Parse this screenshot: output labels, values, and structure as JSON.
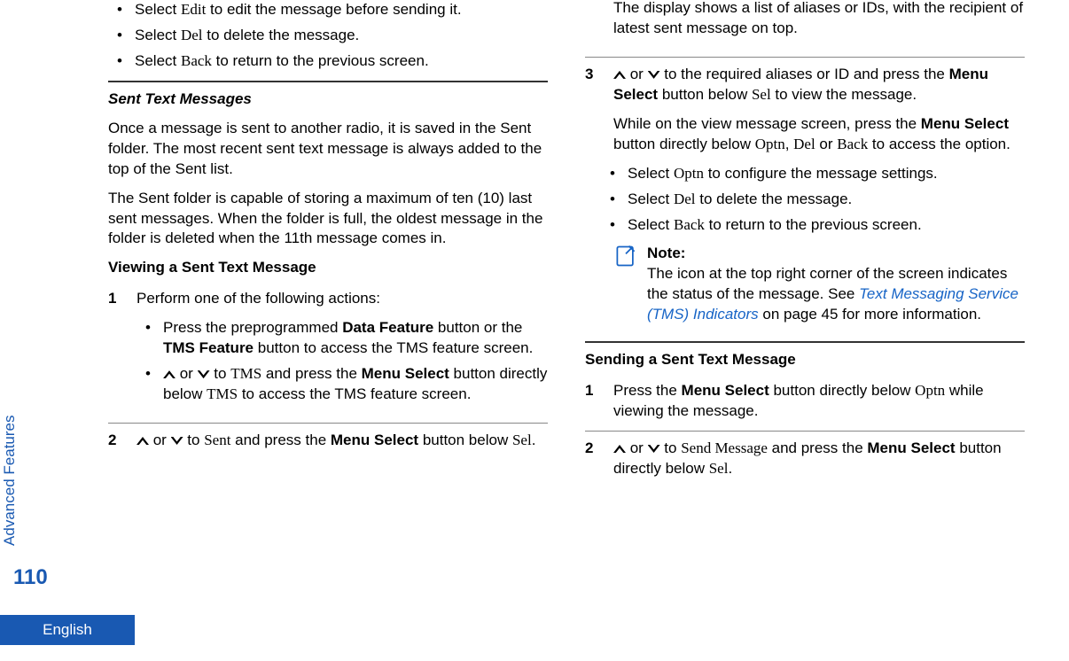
{
  "sidebar": {
    "label": "Advanced Features"
  },
  "pageNumber": "110",
  "language": "English",
  "left": {
    "topBullets": [
      {
        "pre": "Select ",
        "key": "Edit",
        "post": " to edit the message before sending it."
      },
      {
        "pre": "Select ",
        "key": "Del",
        "post": " to delete the message."
      },
      {
        "pre": "Select ",
        "key": "Back",
        "post": " to return to the previous screen."
      }
    ],
    "sentHeading": "Sent Text Messages",
    "sentPara1": "Once a message is sent to another radio, it is saved in the Sent folder. The most recent sent text message is always added to the top of the Sent list.",
    "sentPara2": "The Sent folder is capable of storing a maximum of ten (10) last sent messages. When the folder is full, the oldest message in the folder is deleted when the 11th message comes in.",
    "viewHeading": "Viewing a Sent Text Message",
    "step1Intro": "Perform one of the following actions:",
    "step1Bullet1": {
      "pre": "Press the preprogrammed ",
      "b1": "Data Feature",
      "mid1": " button or the ",
      "b2": "TMS Feature",
      "post": " button to access the TMS feature screen."
    },
    "step1Bullet2": {
      "mid1": " or ",
      "mid2": " to ",
      "key1": "TMS",
      "mid3": " and press the ",
      "b1": "Menu Select",
      "mid4": " button directly below ",
      "key2": "TMS",
      "post": " to access the TMS feature screen."
    },
    "step2": {
      "mid1": " or ",
      "mid2": " to ",
      "key1": "Sent",
      "mid3": " and press the ",
      "b1": "Menu Select",
      "mid4": " button below ",
      "key2": "Sel",
      "post": "."
    }
  },
  "right": {
    "topPara": "The display shows a list of aliases or IDs, with the recipient of latest sent message on top.",
    "step3a": {
      "mid1": " or ",
      "mid2": " to the required aliases or ID and press the ",
      "b1": "Menu Select",
      "mid3": " button below ",
      "key1": "Sel",
      "post": " to view the message."
    },
    "step3b": {
      "pre": "While on the view message screen, press the ",
      "b1": "Menu Select",
      "mid1": " button directly below ",
      "key1": "Optn",
      "sep1": ", ",
      "key2": "Del",
      "mid2": " or ",
      "key3": "Back",
      "post": " to access the option."
    },
    "bullets": [
      {
        "pre": "Select ",
        "key": "Optn",
        "post": " to configure the message settings."
      },
      {
        "pre": "Select ",
        "key": "Del",
        "post": " to delete the message."
      },
      {
        "pre": "Select ",
        "key": "Back",
        "post": " to return to the previous screen."
      }
    ],
    "noteTitle": "Note:",
    "noteBodyPre": "The icon at the top right corner of the screen indicates the status of the message. See ",
    "noteLink": "Text Messaging Service (TMS) Indicators",
    "noteBodyPost": " on page 45 for more information.",
    "sendHeading": "Sending a Sent Text Message",
    "step1": {
      "pre": "Press the ",
      "b1": "Menu Select",
      "mid1": " button directly below ",
      "key1": "Optn",
      "post": " while viewing the message."
    },
    "step2": {
      "mid1": " or ",
      "mid2": " to ",
      "key1": "Send Message",
      "mid3": " and press the ",
      "b1": "Menu Select",
      "mid4": " button directly below ",
      "key2": "Sel",
      "post": "."
    }
  }
}
